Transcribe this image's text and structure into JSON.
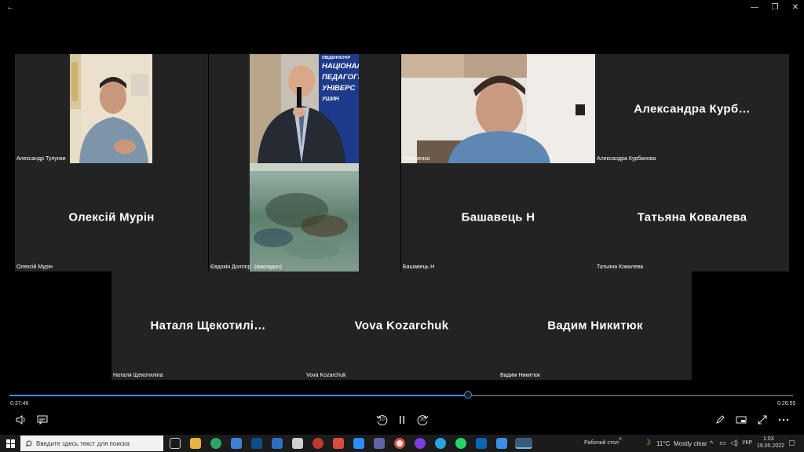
{
  "window": {
    "back_glyph": "←",
    "min_glyph": "—",
    "max_glyph": "❐",
    "close_glyph": "✕"
  },
  "tiles": {
    "tulunki": {
      "label": "Александр Тулунки"
    },
    "dolgier": {
      "label": "Євдокія Долгієр",
      "role": "(викладач)"
    },
    "pekhazenko": {
      "label": "Пенязенко"
    },
    "kurbanova": {
      "name": "Александра  Курб…",
      "label": "Александра Курбанова"
    },
    "murin": {
      "name": "Олексій Мурін",
      "label": "Олексій Мурін"
    },
    "bashavets": {
      "name": "Башавець Н",
      "label": "Башавець Н"
    },
    "kovaleva": {
      "name": "Татьяна Ковалева",
      "label": "Татьяна Ковалева"
    },
    "shchekotilina": {
      "name": "Наталя  Щекотилі…",
      "label": "Наталя Щекотиліна"
    },
    "kozarchuk": {
      "name": "Vova Kozarchuk",
      "label": "Vova Kozarchuk"
    },
    "nikityuk": {
      "name": "Вадим Никитюк",
      "label": "Вадим Никитюк"
    }
  },
  "banner": {
    "lines": [
      "ПІВДЕННОУКР",
      "НАЦІОНАЛ",
      "ПЕДАГОГІ",
      "УНІВЕРС",
      "УШИН"
    ]
  },
  "player": {
    "elapsed": "0:37:46",
    "remaining": "0:26:55",
    "progress": 0.585,
    "accent": "#3a8ee6",
    "rewind_label": "10",
    "forward_label": "30"
  },
  "taskbar": {
    "search_placeholder": "Введите здесь текст для поиска",
    "desktop_label": "Рабочий стол",
    "desktop_chevron": "»",
    "temperature": "11°C",
    "weather": "Mostly clear",
    "language": "УКР",
    "time": "1:03",
    "date": "19.05.2022"
  }
}
